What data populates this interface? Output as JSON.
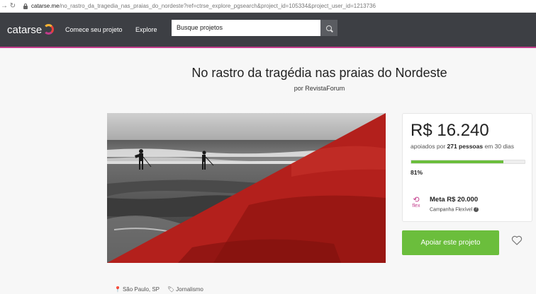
{
  "browser": {
    "back_icon": "arrow-right-icon",
    "reload_icon": "reload-icon",
    "url_domain": "catarse.me",
    "url_rest": "/no_rastro_da_tragedia_nas_praias_do_nordeste?ref=ctrse_explore_pgsearch&project_id=105334&project_user_id=1213736"
  },
  "header": {
    "logo": "catarse",
    "nav": [
      "Comece seu projeto",
      "Explore"
    ],
    "search_placeholder": "Busque projetos",
    "accent_color": "#c23b8b"
  },
  "project": {
    "title": "No rastro da tragédia nas praias do Nordeste",
    "author": "por RevistaForum"
  },
  "stats": {
    "amount": "R$ 16.240",
    "backers_prefix": "apoiados por ",
    "backers_count": "271 pessoas",
    "backers_suffix": " em 30 dias",
    "progress_pct": 81,
    "progress_label": "81%",
    "flex_label": "flex",
    "goal": "Meta R$ 20.000",
    "campaign_type": "Campanha Flexível",
    "bar_color": "#6bbe3c"
  },
  "actions": {
    "support_label": "Apoiar este projeto"
  },
  "meta": {
    "location": "São Paulo, SP",
    "category": "Jornalismo"
  }
}
